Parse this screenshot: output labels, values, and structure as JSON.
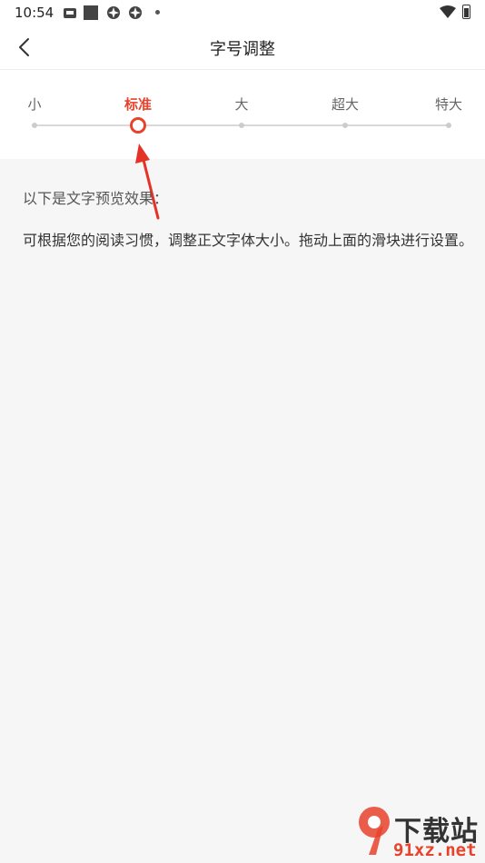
{
  "status_bar": {
    "time": "10:54",
    "icons": [
      "app-icon",
      "square-app-icon",
      "aperture-icon",
      "aperture-icon",
      "dot-icon",
      "wifi-icon",
      "battery-charging-icon"
    ]
  },
  "header": {
    "back_icon": "chevron-left-icon",
    "title": "字号调整"
  },
  "font_size_slider": {
    "options": [
      "小",
      "标准",
      "大",
      "超大",
      "特大"
    ],
    "selected_index": 1,
    "selected_value": "标准",
    "accent_color": "#e8422b"
  },
  "preview": {
    "title": "以下是文字预览效果：",
    "body": "可根据您的阅读习惯，调整正文字体大小。拖动上面的滑块进行设置。"
  },
  "watermark": {
    "logo_text": "9",
    "site_name": "下载站",
    "url": "91xz.net"
  },
  "colors": {
    "accent": "#e8422b",
    "background": "#f6f6f6",
    "panel": "#ffffff"
  }
}
